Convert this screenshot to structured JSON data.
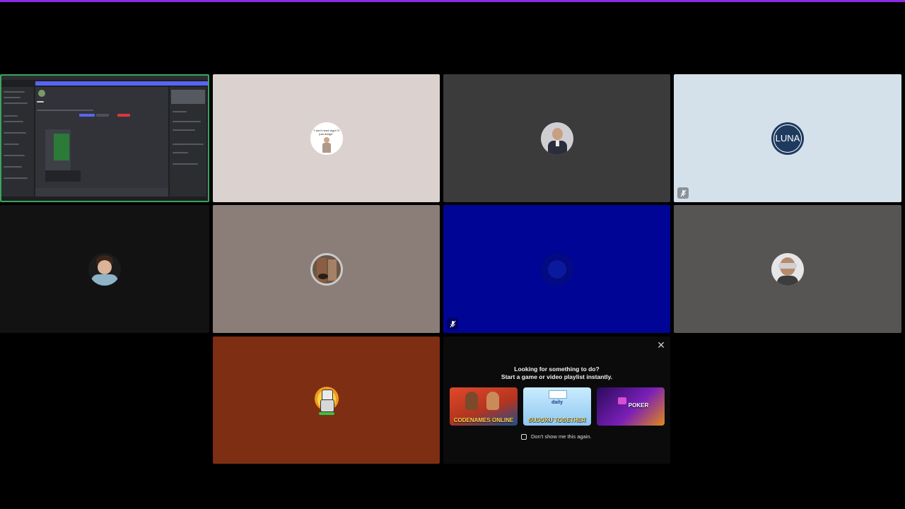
{
  "colors": {
    "accent_bar": "#8b2be2",
    "speaking_border": "#3ba55d",
    "tile_pink": "#dbd2d0",
    "tile_dark_grey": "#3c3b3b",
    "tile_light_blue": "#d4e1eb",
    "tile_black": "#121212",
    "tile_taupe": "#8b7d78",
    "tile_navy": "#000596",
    "tile_grey": "#575454",
    "tile_rust": "#7d2e13"
  },
  "tiles": [
    {
      "id": "screen-share",
      "kind": "screen",
      "speaking": true
    },
    {
      "id": "user-2",
      "avatar": "quote-avatar",
      "avatar_text": "\"I don't need vigor I'll just dodge\"",
      "muted": false
    },
    {
      "id": "user-3",
      "avatar": "person-avatar",
      "muted": false
    },
    {
      "id": "user-4",
      "avatar": "luna-logo-avatar",
      "avatar_text": "LUNA",
      "muted": true
    },
    {
      "id": "user-5",
      "avatar": "person-avatar",
      "muted": false
    },
    {
      "id": "user-6",
      "avatar": "ring-avatar",
      "muted": false
    },
    {
      "id": "user-7",
      "avatar": "dark-blue-avatar",
      "muted": true
    },
    {
      "id": "user-8",
      "avatar": "person-avatar",
      "muted": false
    },
    {
      "id": "user-9",
      "avatar": "robot-fire-avatar",
      "muted": false
    }
  ],
  "activity_prompt": {
    "title": "Looking for something to do?",
    "subtitle": "Start a game or video playlist instantly.",
    "games": [
      {
        "label": "CODENAMES ONLINE",
        "icon": "codenames-icon"
      },
      {
        "label": "SUDOKU TOGETHER",
        "top_label": "daily",
        "icon": "sudoku-icon"
      },
      {
        "label": "POKER",
        "icon": "poker-icon"
      }
    ],
    "dont_show": "Don't show me this again.",
    "close_icon": "close-icon"
  }
}
